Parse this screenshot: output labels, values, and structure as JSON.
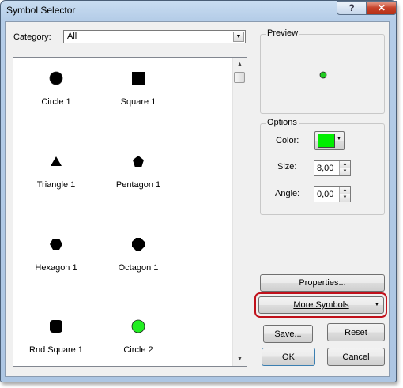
{
  "window": {
    "title": "Symbol Selector",
    "help_glyph": "?",
    "close_glyph": "✕"
  },
  "category": {
    "label": "Category:",
    "value": "All"
  },
  "symbols": [
    {
      "name": "Circle 1",
      "shape": "circle",
      "color": "#000000"
    },
    {
      "name": "Square 1",
      "shape": "square",
      "color": "#000000"
    },
    {
      "name": "Triangle 1",
      "shape": "triangle",
      "color": "#000000"
    },
    {
      "name": "Pentagon 1",
      "shape": "pentagon",
      "color": "#000000"
    },
    {
      "name": "Hexagon 1",
      "shape": "hexagon",
      "color": "#000000"
    },
    {
      "name": "Octagon 1",
      "shape": "octagon",
      "color": "#000000"
    },
    {
      "name": "Rnd Square 1",
      "shape": "rounded-square",
      "color": "#000000"
    },
    {
      "name": "Circle 2",
      "shape": "circle",
      "color": "#22ee22"
    }
  ],
  "preview": {
    "title": "Preview",
    "symbol_color": "#22cc22"
  },
  "options": {
    "title": "Options",
    "color_label": "Color:",
    "color_value": "#00ee00",
    "size_label": "Size:",
    "size_value": "8,00",
    "angle_label": "Angle:",
    "angle_value": "0,00"
  },
  "buttons": {
    "properties": "Properties...",
    "more_symbols": "More Symbols",
    "save": "Save...",
    "reset": "Reset",
    "ok": "OK",
    "cancel": "Cancel"
  },
  "colors": {
    "highlight": "#c0111b",
    "title_bar": "#b5cde8"
  }
}
